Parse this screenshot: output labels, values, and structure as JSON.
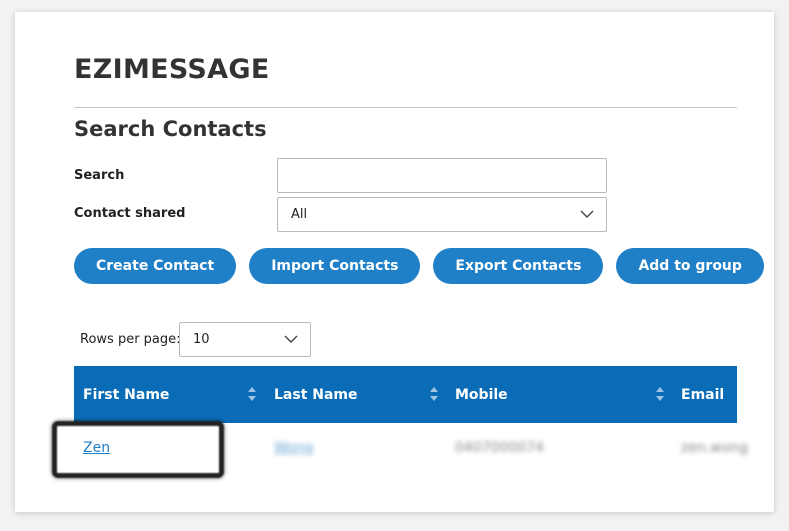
{
  "app": {
    "title": "EZIMESSAGE"
  },
  "search_section": {
    "title": "Search Contacts",
    "search_label": "Search",
    "search_value": "",
    "search_placeholder": "",
    "shared_label": "Contact shared",
    "shared_value": "All"
  },
  "actions": {
    "create": "Create Contact",
    "import": "Import Contacts",
    "export": "Export Contacts",
    "add_group": "Add to group"
  },
  "pagination": {
    "rows_label": "Rows per page:",
    "rows_value": "10"
  },
  "table": {
    "columns": [
      "First Name",
      "Last Name",
      "Mobile",
      "Email"
    ],
    "rows": [
      {
        "first_name": "Zen",
        "last_name": "Wong",
        "mobile": "0407000074",
        "email": "zen.wong"
      }
    ]
  },
  "colors": {
    "accent": "#1f7fc7",
    "header_bg": "#0a6cb7"
  },
  "icons": [
    "chevron-down-icon",
    "sort-icon"
  ]
}
